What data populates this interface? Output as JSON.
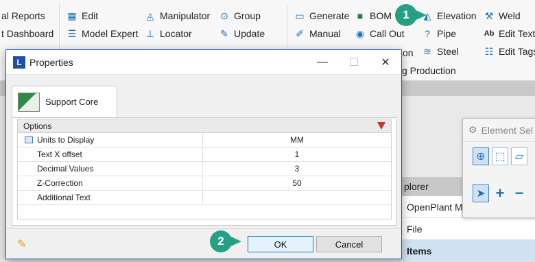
{
  "ribbon": {
    "col1": [
      "al Reports",
      "t Dashboard"
    ],
    "col2": [
      "Edit",
      "Model Expert"
    ],
    "col3": [
      "Manipulator",
      "Locator"
    ],
    "col4": [
      "Group",
      "Update"
    ],
    "col5": [
      "Generate",
      "Manual"
    ],
    "col6": [
      "BOM",
      "Call Out"
    ],
    "col6_extra": "tion",
    "col7": [
      "Elevation",
      "Pipe",
      "Steel"
    ],
    "col8": [
      "Weld",
      "Edit Text",
      "Edit Tags"
    ],
    "production_label": "g Production"
  },
  "explorer": {
    "header": "plorer",
    "rows": [
      "OpenPlant Mo",
      "File",
      "Items"
    ]
  },
  "element_selector": {
    "title": "Element Sel"
  },
  "dialog": {
    "title": "Properties",
    "tab_label": "Support Core",
    "options_header": "Options",
    "rows": [
      {
        "name": "Units to Display",
        "value": "MM"
      },
      {
        "name": "Text X offset",
        "value": "1"
      },
      {
        "name": "Decimal Values",
        "value": "3"
      },
      {
        "name": "Z-Correction",
        "value": "50"
      },
      {
        "name": "Additional Text",
        "value": ""
      }
    ],
    "ok_label": "OK",
    "cancel_label": "Cancel"
  },
  "callouts": {
    "one": "1",
    "two": "2"
  },
  "colors": {
    "callout": "#26a085",
    "accent": "#1f56c7",
    "arrow": "#c0392b"
  }
}
